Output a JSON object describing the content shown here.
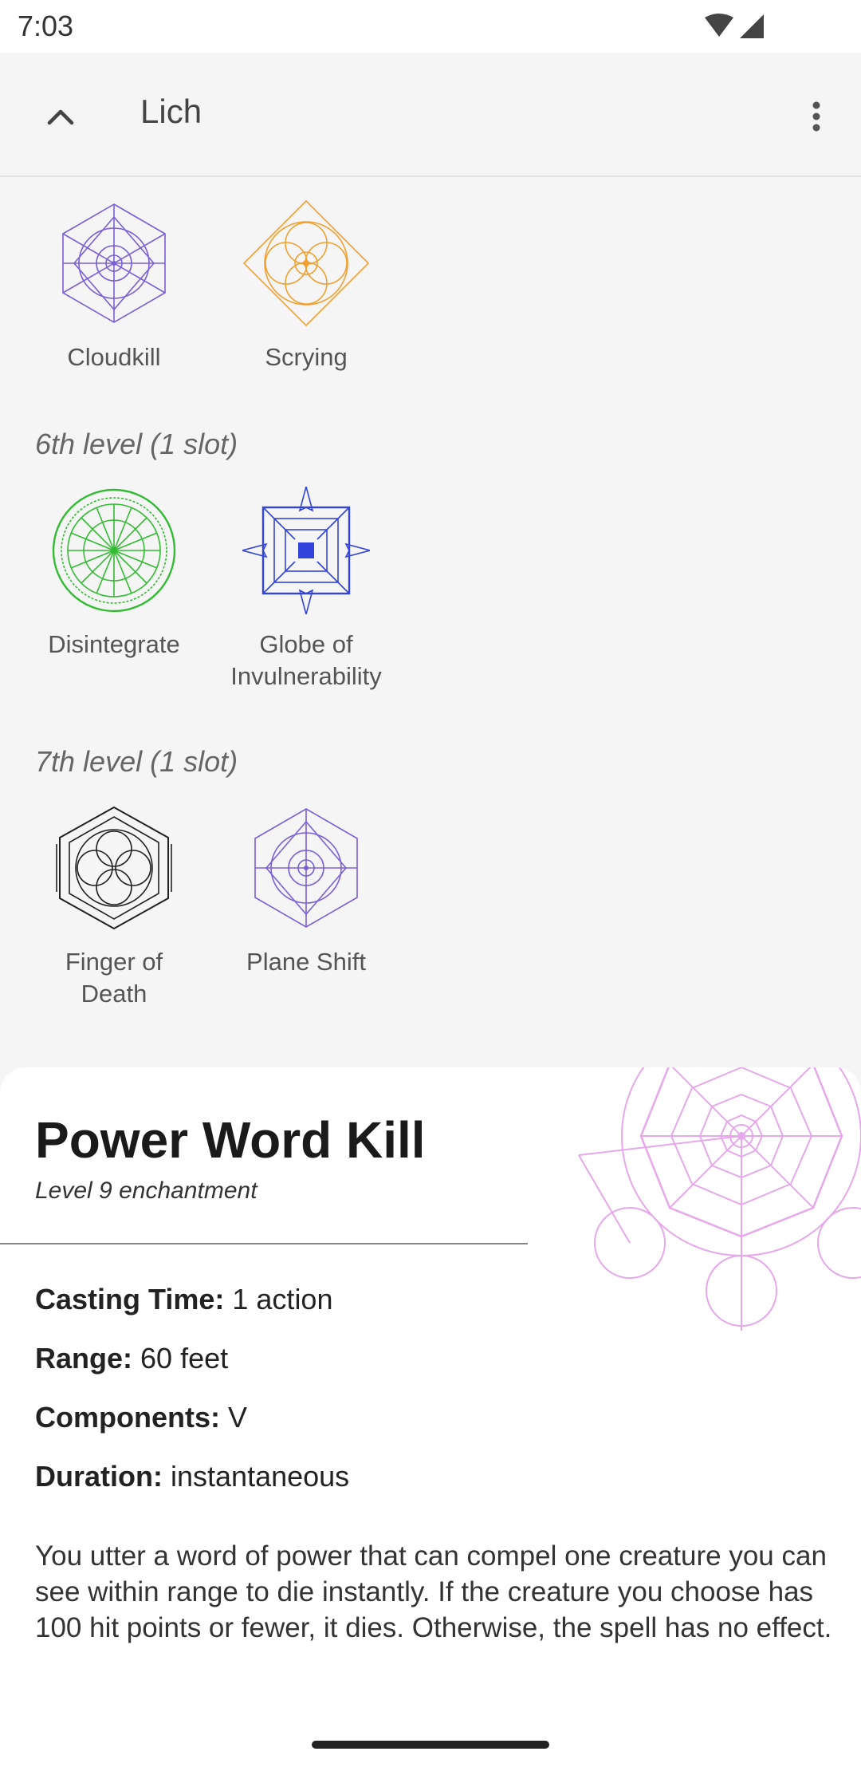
{
  "status": {
    "time": "7:03"
  },
  "app_bar": {
    "title": "Lich"
  },
  "levels": [
    {
      "title": "6th level (1 slot)"
    },
    {
      "title": "7th level (1 slot)"
    }
  ],
  "spells": {
    "cloudkill": "Cloudkill",
    "scrying": "Scrying",
    "disintegrate": "Disintegrate",
    "globe_line1": "Globe of",
    "globe_line2": "Invulnerability",
    "finger_line1": "Finger of",
    "finger_line2": "Death",
    "plane_shift": "Plane Shift"
  },
  "detail": {
    "title": "Power Word Kill",
    "subtitle": "Level 9 enchantment",
    "casting_time_label": "Casting Time:",
    "casting_time": "1 action",
    "range_label": "Range:",
    "range": "60 feet",
    "components_label": "Components:",
    "components": "V",
    "duration_label": "Duration:",
    "duration": "instantaneous",
    "description": "You utter a word of power that can compel one creature you can see within range to die instantly. If the creature you choose has 100 hit points or fewer, it dies. Otherwise, the spell has no effect."
  },
  "colors": {
    "conjuration": "#7b5fd6",
    "divination": "#f0a030",
    "transmutation": "#33bb33",
    "abjuration": "#3344dd",
    "necromancy": "#222222",
    "enchantment": "#e6a8ea"
  }
}
